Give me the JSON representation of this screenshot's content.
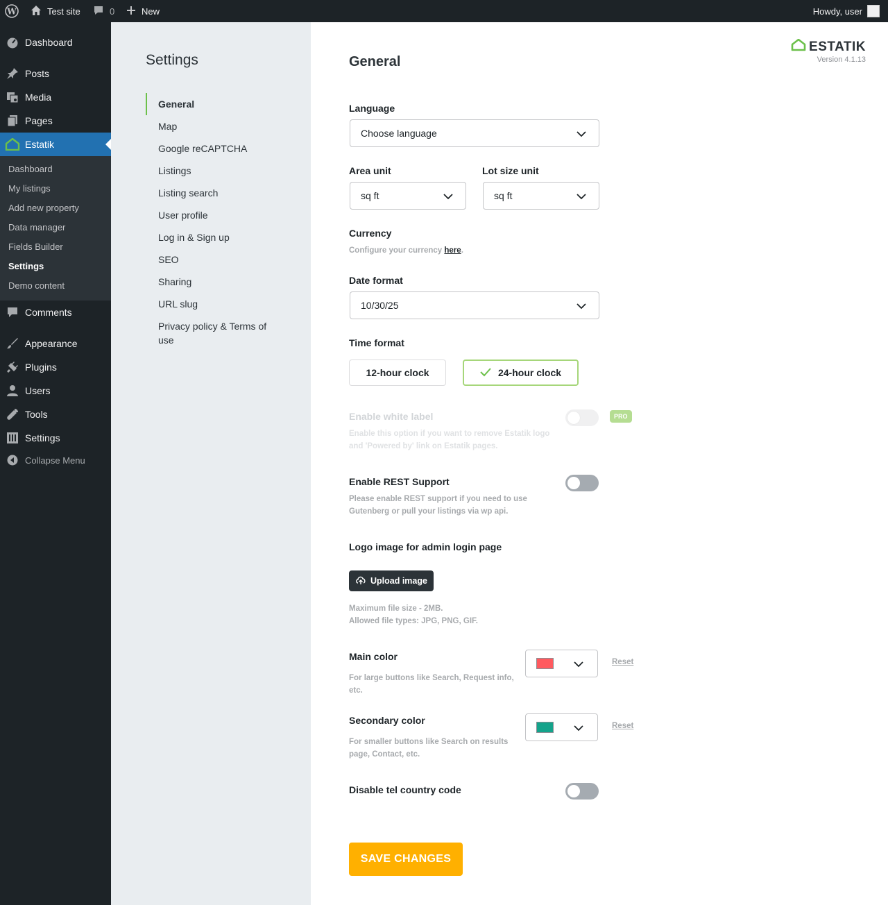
{
  "adminbar": {
    "site_name": "Test site",
    "comments_count": "0",
    "new_label": "New",
    "howdy": "Howdy, user"
  },
  "menu": {
    "dashboard": "Dashboard",
    "posts": "Posts",
    "media": "Media",
    "pages": "Pages",
    "estatik": "Estatik",
    "comments": "Comments",
    "appearance": "Appearance",
    "plugins": "Plugins",
    "users": "Users",
    "tools": "Tools",
    "settings": "Settings",
    "collapse": "Collapse Menu",
    "submenu": [
      "Dashboard",
      "My listings",
      "Add new property",
      "Data manager",
      "Fields Builder",
      "Settings",
      "Demo content"
    ]
  },
  "settings_nav": {
    "title": "Settings",
    "items": [
      "General",
      "Map",
      "Google reCAPTCHA",
      "Listings",
      "Listing search",
      "User profile",
      "Log in & Sign up",
      "SEO",
      "Sharing",
      "URL slug",
      "Privacy policy & Terms of use"
    ]
  },
  "brand": {
    "logo_text": "ESTATIK",
    "version": "Version 4.1.13",
    "accent": "#6cc04a"
  },
  "general": {
    "title": "General",
    "language_label": "Language",
    "language_value": "Choose language",
    "area_unit_label": "Area unit",
    "area_unit_value": "sq ft",
    "lot_size_label": "Lot size unit",
    "lot_size_value": "sq ft",
    "currency_label": "Currency",
    "currency_help_prefix": "Configure your currency ",
    "currency_help_link": "here",
    "currency_help_suffix": ".",
    "date_format_label": "Date format",
    "date_format_value": "10/30/25",
    "time_format_label": "Time format",
    "time_12": "12-hour clock",
    "time_24": "24-hour clock",
    "time_selected": "24-hour clock",
    "white_label_label": "Enable white label",
    "white_label_help": "Enable this option if you want to remove Estatik logo and 'Powered by' link on Estatik pages.",
    "pro_badge": "PRO",
    "rest_label": "Enable REST Support",
    "rest_help": "Please enable REST support if you need to use Gutenberg or pull your listings via wp api.",
    "logo_image_label": "Logo image for admin login page",
    "upload_label": "Upload image",
    "upload_help_1": "Maximum file size - 2MB.",
    "upload_help_2": "Allowed file types: JPG, PNG, GIF.",
    "main_color_label": "Main color",
    "main_color_help": "For large buttons like Search, Request info, etc.",
    "main_color": "#ff5a5f",
    "secondary_color_label": "Secondary color",
    "secondary_color_help": "For smaller buttons like Search on results page, Contact, etc.",
    "secondary_color": "#14a38b",
    "reset_label": "Reset",
    "tel_label": "Disable tel country code",
    "save_label": "SAVE CHANGES",
    "save_color": "#ffb000"
  }
}
